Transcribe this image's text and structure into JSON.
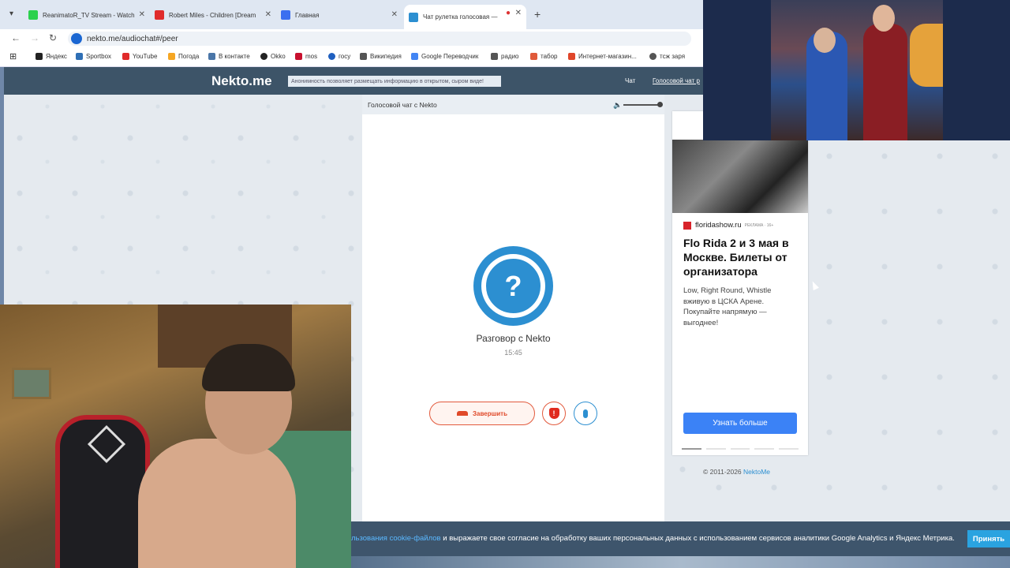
{
  "browser": {
    "tabs": [
      {
        "title": "ReanimatoR_TV Stream - Watch",
        "color": "#2bd14c"
      },
      {
        "title": "Robert Miles - Children [Dream",
        "color": "#e02b2b"
      },
      {
        "title": "Главная",
        "color": "#3b6ff0"
      },
      {
        "title": "Чат рулетка голосовая —",
        "color": "#2c8fd1"
      }
    ],
    "url": "nekto.me/audiochat#/peer",
    "bookmarks": [
      {
        "label": "Яндекс",
        "color": "#222"
      },
      {
        "label": "Sportbox",
        "color": "#2f6fb5"
      },
      {
        "label": "YouTube",
        "color": "#e02b2b"
      },
      {
        "label": "Погода",
        "color": "#f5a623"
      },
      {
        "label": "В контакте",
        "color": "#4a76a8"
      },
      {
        "label": "Okko",
        "color": "#222"
      },
      {
        "label": "mos",
        "color": "#c8102e"
      },
      {
        "label": "госу",
        "color": "#1f5fbf"
      },
      {
        "label": "Википедия",
        "color": "#555"
      },
      {
        "label": "Google Переводчик",
        "color": "#4285f4"
      },
      {
        "label": "радио",
        "color": "#555"
      },
      {
        "label": "табор",
        "color": "#e05a3a"
      },
      {
        "label": "Интернет-магазин...",
        "color": "#e0462a"
      },
      {
        "label": "тсж заря",
        "color": "#555"
      }
    ]
  },
  "site": {
    "logo": "Nekto.me",
    "anon_notice": "Анонимность позволяет размещать информацию в открытом, сыром виде!",
    "nav_chat": "Чат",
    "nav_voice": "Голосовой чат р"
  },
  "chat": {
    "header": "Голосовой чат с Nekto",
    "volume": 1.0,
    "avatar_symbol": "?",
    "conversation_title": "Разговор с Nekto",
    "timer": "15:45",
    "end_label": "Завершить",
    "report_symbol": "!"
  },
  "ad": {
    "site": "floridashow.ru",
    "tag": "РЕКЛАМА · 16+",
    "title": "Flo Rida 2 и 3 мая в Москве. Билеты от организатора",
    "text": "Low, Right Round, Whistle вживую в ЦСКА Арене. Покупайте напрямую — выгоднее!",
    "button": "Узнать больше"
  },
  "footer": {
    "copyright": "© 2011-2026 ",
    "brand": "NektoMe"
  },
  "cookie": {
    "link": "льзования cookie-файлов",
    "text": " и выражаете свое согласие на обработку ваших персональных данных с использованием сервисов аналитики Google Analytics и Яндекс Метрика.",
    "accept": "Принять"
  },
  "colors": {
    "accent": "#2c8fd1",
    "danger": "#e04a2a",
    "header": "#3d5468"
  }
}
